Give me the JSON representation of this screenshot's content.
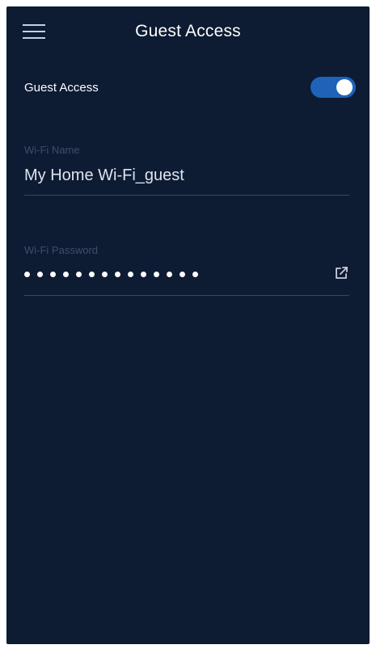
{
  "header": {
    "title": "Guest Access",
    "menu_icon": "hamburger-menu-icon"
  },
  "guest_access": {
    "label": "Guest Access",
    "enabled": true,
    "toggle_color": "#1e63b8"
  },
  "wifi_name": {
    "label": "Wi-Fi Name",
    "value": "My Home Wi-Fi_guest"
  },
  "wifi_password": {
    "label": "Wi-Fi Password",
    "masked_length": 14,
    "share_icon": "share-external-icon"
  },
  "colors": {
    "background": "#0d1b33",
    "text": "#ffffff",
    "label_muted": "#3f4d66",
    "divider": "#3a4760",
    "accent": "#1e63b8"
  }
}
